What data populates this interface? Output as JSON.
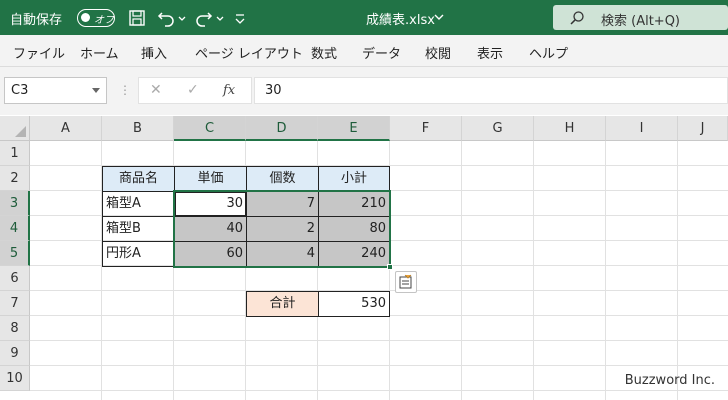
{
  "titlebar": {
    "autosave_label": "自動保存",
    "toggle_text": "オフ",
    "document_title": "成績表.xlsx",
    "search_text": "検索 (Alt+Q)",
    "accent_color": "#217346"
  },
  "ribbon": {
    "tabs": [
      "ファイル",
      "ホーム",
      "挿入",
      "ページ レイアウト",
      "数式",
      "データ",
      "校閲",
      "表示",
      "ヘルプ"
    ]
  },
  "formula_bar": {
    "name_box": "C3",
    "cancel_icon": "✕",
    "enter_icon": "✓",
    "fx_label": "fx",
    "formula_value": "30"
  },
  "grid": {
    "columns": [
      "A",
      "B",
      "C",
      "D",
      "E",
      "F",
      "G",
      "H",
      "I",
      "J"
    ],
    "selected_columns": [
      "C",
      "D",
      "E"
    ],
    "rows": [
      "1",
      "2",
      "3",
      "4",
      "5",
      "6",
      "7",
      "8",
      "9",
      "10"
    ],
    "selected_rows": [
      "3",
      "4",
      "5"
    ],
    "table_header": [
      "商品名",
      "単価",
      "個数",
      "小計"
    ],
    "table_rows": [
      [
        "箱型A",
        "30",
        "7",
        "210"
      ],
      [
        "箱型B",
        "40",
        "2",
        "80"
      ],
      [
        "円形A",
        "60",
        "4",
        "240"
      ]
    ],
    "total_label": "合計",
    "total_value": "530",
    "active_cell": "C3",
    "selection_range": "C3:E5",
    "header_fill": "#ddebf7",
    "total_fill": "#fce4d6",
    "selection_fill": "#c6c6c6"
  },
  "quick_analysis_icon": "quick-analysis-icon",
  "watermark": "Buzzword Inc."
}
